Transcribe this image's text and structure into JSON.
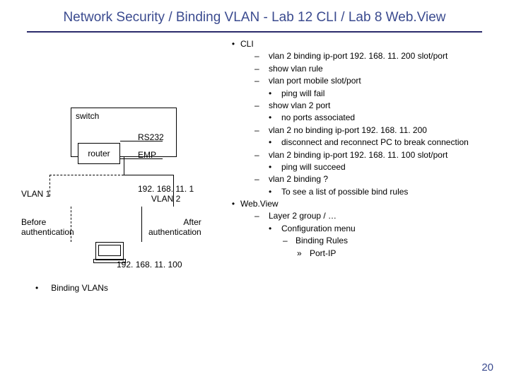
{
  "title": "Network Security / Binding VLAN - Lab 12 CLI / Lab 8 Web.View",
  "diagram": {
    "switch": "switch",
    "router": "router",
    "rs232": "RS232",
    "emp": "EMP",
    "vlan1": "VLAN 1",
    "ip1_line1": "192. 168. 11. 1",
    "ip1_line2": "VLAN 2",
    "before_l1": "Before",
    "before_l2": "authentication",
    "after_l1": "After",
    "after_l2": "authentication",
    "ip100": "192. 168. 11. 100"
  },
  "binding_label": "Binding VLANs",
  "cli": {
    "head": "CLI",
    "i1": "vlan 2 binding ip-port 192. 168. 11. 200 slot/port",
    "i2": "show vlan rule",
    "i3": "vlan port mobile slot/port",
    "i3a": "ping will fail",
    "i4": "show vlan 2 port",
    "i4a": "no ports associated",
    "i5": "vlan 2 no binding ip-port 192. 168. 11. 200",
    "i5a": "disconnect and reconnect PC to break connection",
    "i6": "vlan 2 binding ip-port 192. 168. 11. 100 slot/port",
    "i6a": "ping will succeed",
    "i7": "vlan 2 binding ?",
    "i7a": "To see a list of possible bind rules"
  },
  "web": {
    "head": "Web.View",
    "i1": "Layer 2 group / …",
    "i1a": "Configuration menu",
    "i1a1": "Binding Rules",
    "i1a1a": "Port-IP"
  },
  "pagenum": "20"
}
